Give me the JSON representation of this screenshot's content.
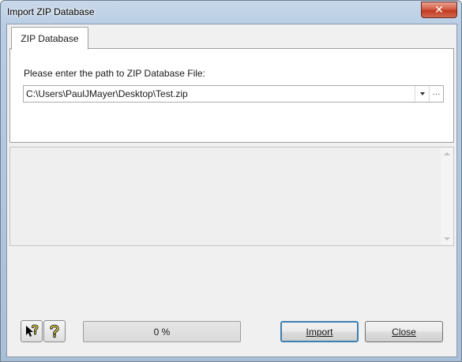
{
  "window": {
    "title": "Import ZIP Database"
  },
  "tabs": [
    {
      "label": "ZIP Database"
    }
  ],
  "form": {
    "prompt": "Please enter the path to ZIP Database File:",
    "path_value": "C:\\Users\\PaulJMayer\\Desktop\\Test.zip",
    "browse_label": "···"
  },
  "progress": {
    "text": "0 %",
    "value": 0
  },
  "buttons": {
    "import_label": "Import",
    "close_label": "Close"
  },
  "icons": {
    "close": "close-icon",
    "dropdown": "chevron-down-icon",
    "context_help": "whats-this-help-icon",
    "help": "help-icon"
  },
  "colors": {
    "progress_fill": "#4fbf3a",
    "close_button": "#c23a22",
    "default_focus": "#3c7fb1"
  }
}
